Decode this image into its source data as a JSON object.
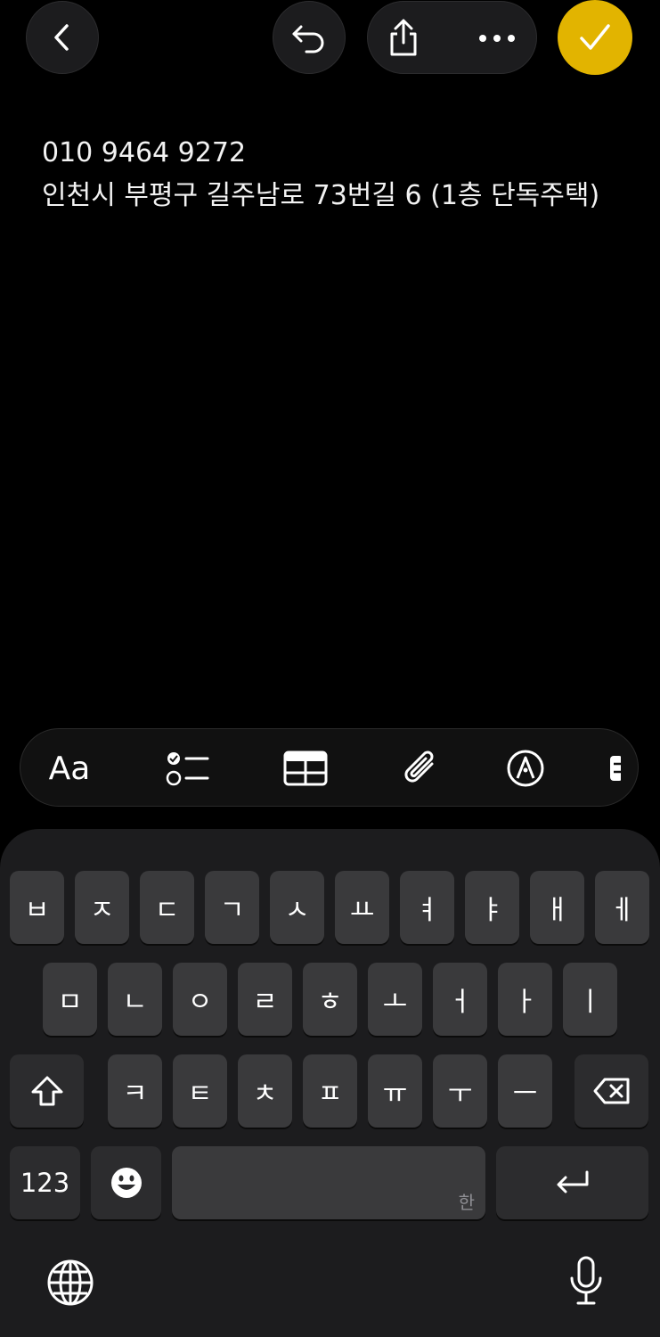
{
  "note": {
    "lines": [
      "010 9464 9272",
      "인천시 부평구 길주남로 73번길 6 (1층 단독주택)"
    ]
  },
  "format_toolbar": {
    "text_style_label": "Aa",
    "items": [
      "text-style",
      "checklist",
      "table",
      "attachment",
      "markup",
      "more"
    ]
  },
  "keyboard": {
    "row1": [
      "ㅂ",
      "ㅈ",
      "ㄷ",
      "ㄱ",
      "ㅅ",
      "ㅛ",
      "ㅕ",
      "ㅑ",
      "ㅐ",
      "ㅔ"
    ],
    "row2": [
      "ㅁ",
      "ㄴ",
      "ㅇ",
      "ㄹ",
      "ㅎ",
      "ㅗ",
      "ㅓ",
      "ㅏ",
      "ㅣ"
    ],
    "row3": [
      "ㅋ",
      "ㅌ",
      "ㅊ",
      "ㅍ",
      "ㅠ",
      "ㅜ",
      "ㅡ"
    ],
    "numbers_label": "123",
    "space_hint": "한"
  },
  "colors": {
    "accent": "#e2b400",
    "key": "#3a3a3c",
    "keyboard_bg": "#1c1c1e"
  }
}
